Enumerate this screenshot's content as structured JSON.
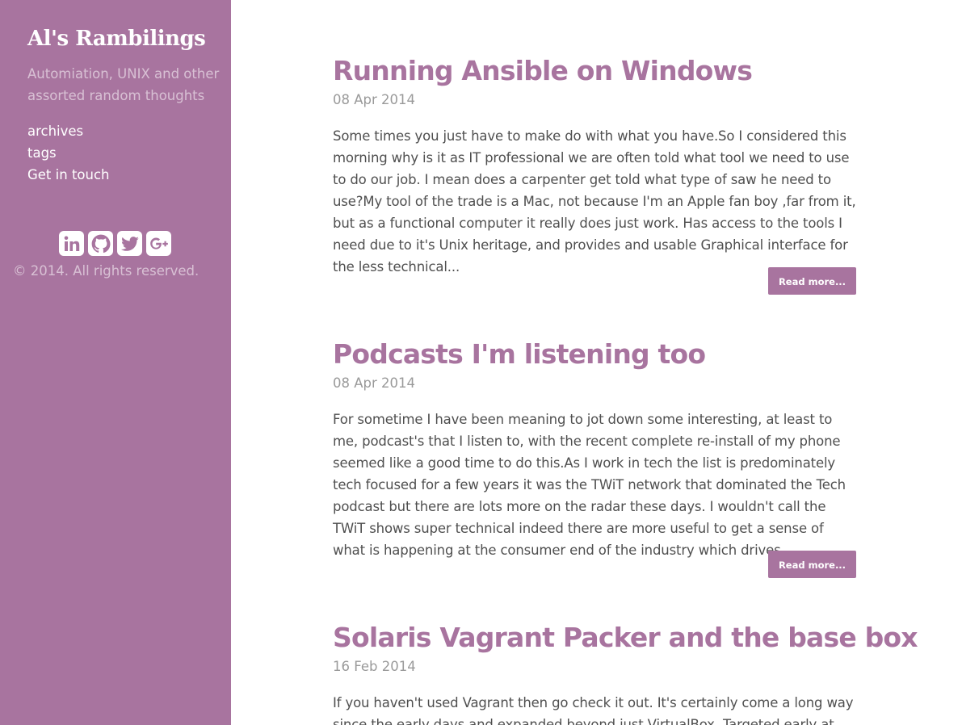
{
  "sidebar": {
    "title": "Al's Rambilings",
    "tagline": "Automiation, UNIX and other assorted random thoughts",
    "nav": [
      {
        "label": "archives"
      },
      {
        "label": "tags"
      },
      {
        "label": "Get in touch"
      }
    ],
    "social_icons": [
      "linkedin-icon",
      "github-icon",
      "twitter-icon",
      "google-plus-icon"
    ],
    "copyright": "© 2014. All rights reserved."
  },
  "colors": {
    "accent": "#a8749f",
    "text": "#4f4f4f",
    "muted": "#9a9a9a"
  },
  "posts": [
    {
      "title": "Running Ansible on Windows",
      "date": "08 Apr 2014",
      "excerpt": "Some times you just have to make do with what you have.So I considered this morning why is it as IT professional we are often told what tool we need to use to do our job. I mean does a carpenter get told what type of saw he need to use?My tool of the trade is a Mac, not because I'm an Apple fan boy ,far from it, but as a functional computer it really does just work. Has access to the tools I need due to it's Unix heritage, and provides and usable Graphical interface for the less technical...",
      "read_more": "Read more..."
    },
    {
      "title": "Podcasts I'm listening too",
      "date": "08 Apr 2014",
      "excerpt": "For sometime I have been meaning to jot down some interesting, at least to me, podcast's that I listen to, with the recent complete re-install of my phone seemed like a good time to do this.As I work in tech the list is predominately tech focused for a few years it was the TWiT network that dominated the Tech podcast but there are lots more on the radar these days. I wouldn't call the TWiT shows super technical indeed there are more useful to get a sense of what is happening at the consumer end of the industry which drives...",
      "read_more": "Read more..."
    },
    {
      "title": "Solaris Vagrant Packer and the base box",
      "date": "16 Feb 2014",
      "excerpt": "If you haven't used Vagrant then go check it out. It's certainly come a long way since the early days and expanded beyond just VirtualBox. Targeted early at"
    }
  ]
}
